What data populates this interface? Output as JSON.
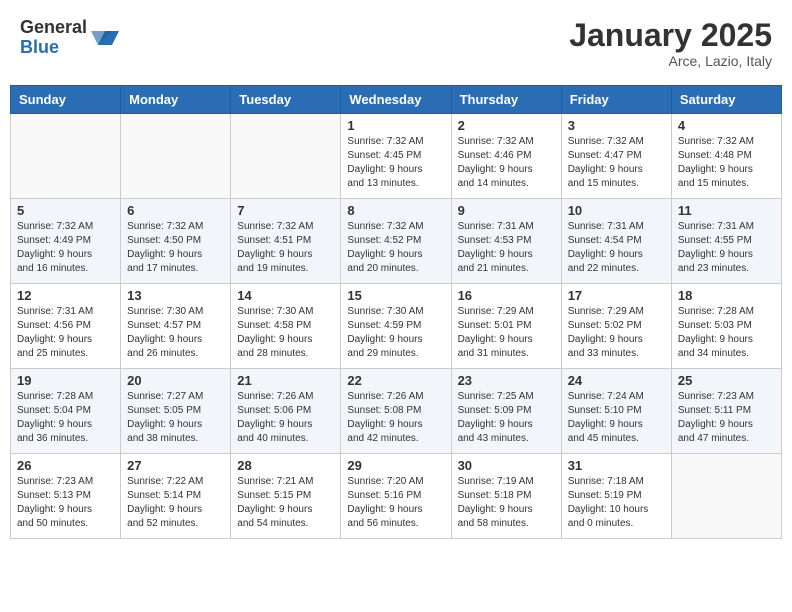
{
  "header": {
    "logo_general": "General",
    "logo_blue": "Blue",
    "month_title": "January 2025",
    "location": "Arce, Lazio, Italy"
  },
  "weekdays": [
    "Sunday",
    "Monday",
    "Tuesday",
    "Wednesday",
    "Thursday",
    "Friday",
    "Saturday"
  ],
  "weeks": [
    [
      {
        "day": "",
        "info": ""
      },
      {
        "day": "",
        "info": ""
      },
      {
        "day": "",
        "info": ""
      },
      {
        "day": "1",
        "info": "Sunrise: 7:32 AM\nSunset: 4:45 PM\nDaylight: 9 hours\nand 13 minutes."
      },
      {
        "day": "2",
        "info": "Sunrise: 7:32 AM\nSunset: 4:46 PM\nDaylight: 9 hours\nand 14 minutes."
      },
      {
        "day": "3",
        "info": "Sunrise: 7:32 AM\nSunset: 4:47 PM\nDaylight: 9 hours\nand 15 minutes."
      },
      {
        "day": "4",
        "info": "Sunrise: 7:32 AM\nSunset: 4:48 PM\nDaylight: 9 hours\nand 15 minutes."
      }
    ],
    [
      {
        "day": "5",
        "info": "Sunrise: 7:32 AM\nSunset: 4:49 PM\nDaylight: 9 hours\nand 16 minutes."
      },
      {
        "day": "6",
        "info": "Sunrise: 7:32 AM\nSunset: 4:50 PM\nDaylight: 9 hours\nand 17 minutes."
      },
      {
        "day": "7",
        "info": "Sunrise: 7:32 AM\nSunset: 4:51 PM\nDaylight: 9 hours\nand 19 minutes."
      },
      {
        "day": "8",
        "info": "Sunrise: 7:32 AM\nSunset: 4:52 PM\nDaylight: 9 hours\nand 20 minutes."
      },
      {
        "day": "9",
        "info": "Sunrise: 7:31 AM\nSunset: 4:53 PM\nDaylight: 9 hours\nand 21 minutes."
      },
      {
        "day": "10",
        "info": "Sunrise: 7:31 AM\nSunset: 4:54 PM\nDaylight: 9 hours\nand 22 minutes."
      },
      {
        "day": "11",
        "info": "Sunrise: 7:31 AM\nSunset: 4:55 PM\nDaylight: 9 hours\nand 23 minutes."
      }
    ],
    [
      {
        "day": "12",
        "info": "Sunrise: 7:31 AM\nSunset: 4:56 PM\nDaylight: 9 hours\nand 25 minutes."
      },
      {
        "day": "13",
        "info": "Sunrise: 7:30 AM\nSunset: 4:57 PM\nDaylight: 9 hours\nand 26 minutes."
      },
      {
        "day": "14",
        "info": "Sunrise: 7:30 AM\nSunset: 4:58 PM\nDaylight: 9 hours\nand 28 minutes."
      },
      {
        "day": "15",
        "info": "Sunrise: 7:30 AM\nSunset: 4:59 PM\nDaylight: 9 hours\nand 29 minutes."
      },
      {
        "day": "16",
        "info": "Sunrise: 7:29 AM\nSunset: 5:01 PM\nDaylight: 9 hours\nand 31 minutes."
      },
      {
        "day": "17",
        "info": "Sunrise: 7:29 AM\nSunset: 5:02 PM\nDaylight: 9 hours\nand 33 minutes."
      },
      {
        "day": "18",
        "info": "Sunrise: 7:28 AM\nSunset: 5:03 PM\nDaylight: 9 hours\nand 34 minutes."
      }
    ],
    [
      {
        "day": "19",
        "info": "Sunrise: 7:28 AM\nSunset: 5:04 PM\nDaylight: 9 hours\nand 36 minutes."
      },
      {
        "day": "20",
        "info": "Sunrise: 7:27 AM\nSunset: 5:05 PM\nDaylight: 9 hours\nand 38 minutes."
      },
      {
        "day": "21",
        "info": "Sunrise: 7:26 AM\nSunset: 5:06 PM\nDaylight: 9 hours\nand 40 minutes."
      },
      {
        "day": "22",
        "info": "Sunrise: 7:26 AM\nSunset: 5:08 PM\nDaylight: 9 hours\nand 42 minutes."
      },
      {
        "day": "23",
        "info": "Sunrise: 7:25 AM\nSunset: 5:09 PM\nDaylight: 9 hours\nand 43 minutes."
      },
      {
        "day": "24",
        "info": "Sunrise: 7:24 AM\nSunset: 5:10 PM\nDaylight: 9 hours\nand 45 minutes."
      },
      {
        "day": "25",
        "info": "Sunrise: 7:23 AM\nSunset: 5:11 PM\nDaylight: 9 hours\nand 47 minutes."
      }
    ],
    [
      {
        "day": "26",
        "info": "Sunrise: 7:23 AM\nSunset: 5:13 PM\nDaylight: 9 hours\nand 50 minutes."
      },
      {
        "day": "27",
        "info": "Sunrise: 7:22 AM\nSunset: 5:14 PM\nDaylight: 9 hours\nand 52 minutes."
      },
      {
        "day": "28",
        "info": "Sunrise: 7:21 AM\nSunset: 5:15 PM\nDaylight: 9 hours\nand 54 minutes."
      },
      {
        "day": "29",
        "info": "Sunrise: 7:20 AM\nSunset: 5:16 PM\nDaylight: 9 hours\nand 56 minutes."
      },
      {
        "day": "30",
        "info": "Sunrise: 7:19 AM\nSunset: 5:18 PM\nDaylight: 9 hours\nand 58 minutes."
      },
      {
        "day": "31",
        "info": "Sunrise: 7:18 AM\nSunset: 5:19 PM\nDaylight: 10 hours\nand 0 minutes."
      },
      {
        "day": "",
        "info": ""
      }
    ]
  ]
}
